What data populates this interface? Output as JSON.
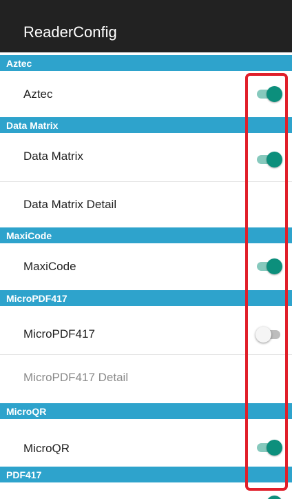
{
  "appbar": {
    "title": "ReaderConfig"
  },
  "sections": {
    "aztec": "Aztec",
    "data_matrix": "Data Matrix",
    "maxicode": "MaxiCode",
    "micropdf417": "MicroPDF417",
    "microqr": "MicroQR",
    "pdf417": "PDF417"
  },
  "rows": {
    "aztec": {
      "label": "Aztec",
      "enabled": true
    },
    "data_matrix": {
      "label": "Data Matrix",
      "enabled": true
    },
    "data_matrix_detail": {
      "label": "Data Matrix Detail"
    },
    "maxicode": {
      "label": "MaxiCode",
      "enabled": true
    },
    "micropdf417": {
      "label": "MicroPDF417",
      "enabled": false
    },
    "micropdf417_detail": {
      "label": "MicroPDF417 Detail",
      "disabled": true
    },
    "microqr": {
      "label": "MicroQR",
      "enabled": true
    },
    "pdf417": {
      "enabled": true
    }
  },
  "colors": {
    "appbar": "#222222",
    "section_header": "#2ea3cc",
    "switch_on": "#0c8f7c",
    "switch_on_track": "#86c9bd",
    "switch_off_track": "#bdbdbd",
    "highlight": "#e01f2a"
  }
}
